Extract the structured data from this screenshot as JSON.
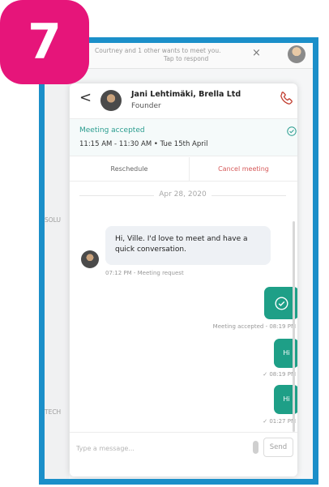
{
  "step_badge": "7",
  "notification": {
    "line1": "Courtney and 1 other wants to meet you.",
    "line2": "Tap to respond",
    "close_glyph": "×"
  },
  "background": {
    "label_solu": "SOLU",
    "label_tech": "TECH"
  },
  "chat": {
    "back_glyph": "<",
    "contact_name": "Jani Lehtimäki, Brella Ltd",
    "contact_title": "Founder",
    "meeting_status": "Meeting accepted",
    "meeting_time": "11:15 AM - 11:30 AM • Tue 15th April",
    "reschedule_label": "Reschedule",
    "cancel_label": "Cancel meeting",
    "date_separator": "Apr 28, 2020",
    "messages": [
      {
        "direction": "in",
        "text": "Hi, Ville. I'd love to meet and have a quick conversation.",
        "meta": "07:12 PM - Meeting request"
      },
      {
        "direction": "out",
        "type": "accepted",
        "meta": "Meeting accepted - 08:19 PM"
      },
      {
        "direction": "out",
        "text": "Hi",
        "meta": "✓ 08:19 PM"
      },
      {
        "direction": "out",
        "text": "Hi",
        "meta": "✓ 01:27 PM"
      }
    ],
    "composer": {
      "placeholder": "Type a message...",
      "send_label": "Send"
    }
  },
  "colors": {
    "accent_green": "#1e9f87",
    "status_green": "#2a9d8f",
    "cancel_red": "#d65a5a",
    "frame_blue": "#1b8fc9",
    "badge_pink": "#e6157a"
  }
}
